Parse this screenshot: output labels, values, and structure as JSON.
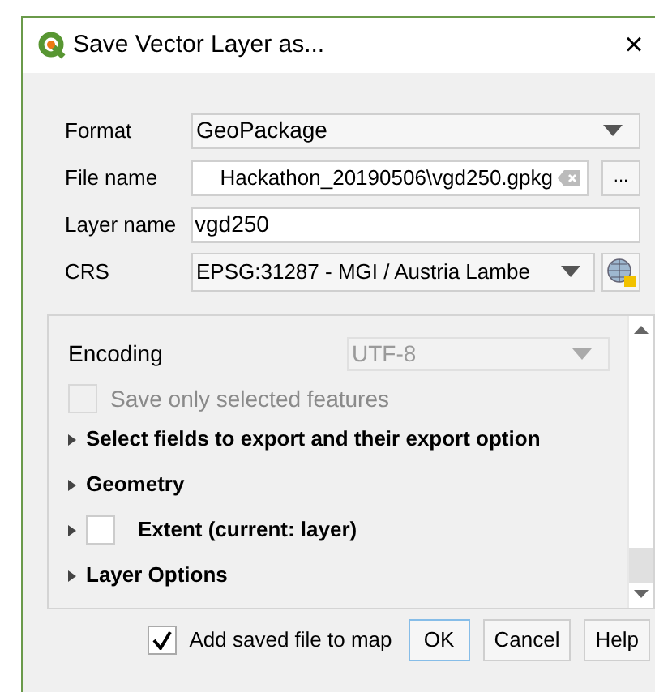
{
  "window": {
    "title": "Save Vector Layer as...",
    "close": "×"
  },
  "form": [
    {
      "kind": "combo",
      "label": "Format",
      "value": "GeoPackage"
    },
    {
      "kind": "file",
      "label": "File name",
      "value": "Hackathon_20190506\\vgd250.gpkg",
      "browse": "..."
    },
    {
      "kind": "text",
      "label": "Layer name",
      "value": "vgd250"
    },
    {
      "kind": "crs",
      "label": "CRS",
      "value": "EPSG:31287 - MGI / Austria Lambe"
    }
  ],
  "options": {
    "encoding": {
      "label": "Encoding",
      "value": "UTF-8",
      "disabled": true
    },
    "save_selected": {
      "label": "Save only selected features",
      "checked": false,
      "disabled": true
    },
    "sections": [
      {
        "label": "Select fields to export and their export option",
        "expanded": false,
        "kind": "plain"
      },
      {
        "label": "Geometry",
        "expanded": false,
        "kind": "plain"
      },
      {
        "label": "Extent (current: layer)",
        "expanded": false,
        "kind": "checkable",
        "checked": false
      },
      {
        "label": "Layer Options",
        "expanded": false,
        "kind": "plain"
      }
    ]
  },
  "footer": {
    "add_to_map": {
      "label": "Add saved file to map",
      "checked": true
    },
    "buttons": [
      "OK",
      "Cancel",
      "Help"
    ]
  }
}
